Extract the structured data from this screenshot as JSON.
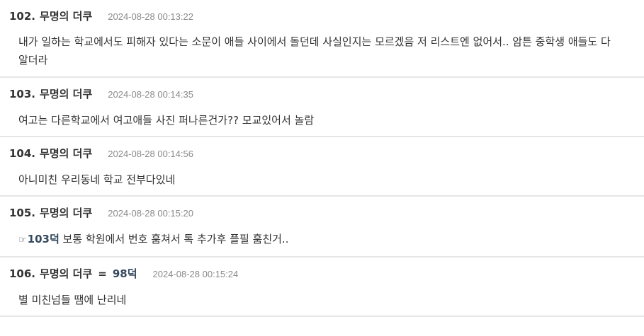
{
  "posts": [
    {
      "number": "102.",
      "author": "무명의 더쿠",
      "timestamp": "2024-08-28 00:13:22",
      "body": "내가 일하는 학교에서도 피해자 있다는 소문이 애들 사이에서 돌던데 사실인지는 모르겠음 저 리스트엔 없어서.. 암튼 중학생 애들도 다 알더라"
    },
    {
      "number": "103.",
      "author": "무명의 더쿠",
      "timestamp": "2024-08-28 00:14:35",
      "body": "여고는 다른학교에서 여고애들 사진 퍼나른건가?? 모교있어서 놀람"
    },
    {
      "number": "104.",
      "author": "무명의 더쿠",
      "timestamp": "2024-08-28 00:14:56",
      "body": "아니미친 우리동네 학교 전부다있네"
    },
    {
      "number": "105.",
      "author": "무명의 더쿠",
      "timestamp": "2024-08-28 00:15:20",
      "anchor_icon": "pointing-hand-icon",
      "anchor_text": "103덕",
      "body": " 보통 학원에서 번호 훔쳐서 톡 추가후 플필 훔친거.."
    },
    {
      "number": "106.",
      "author": "무명의 더쿠",
      "reply_eq": "=",
      "reply_ref": "98덕",
      "timestamp": "2024-08-28 00:15:24",
      "body": "별 미친넘들 땜에 난리네"
    }
  ],
  "colors": {
    "text": "#333333",
    "timestamp": "#8a8a8a",
    "link": "#34495e",
    "divider": "#e6e6e6"
  }
}
